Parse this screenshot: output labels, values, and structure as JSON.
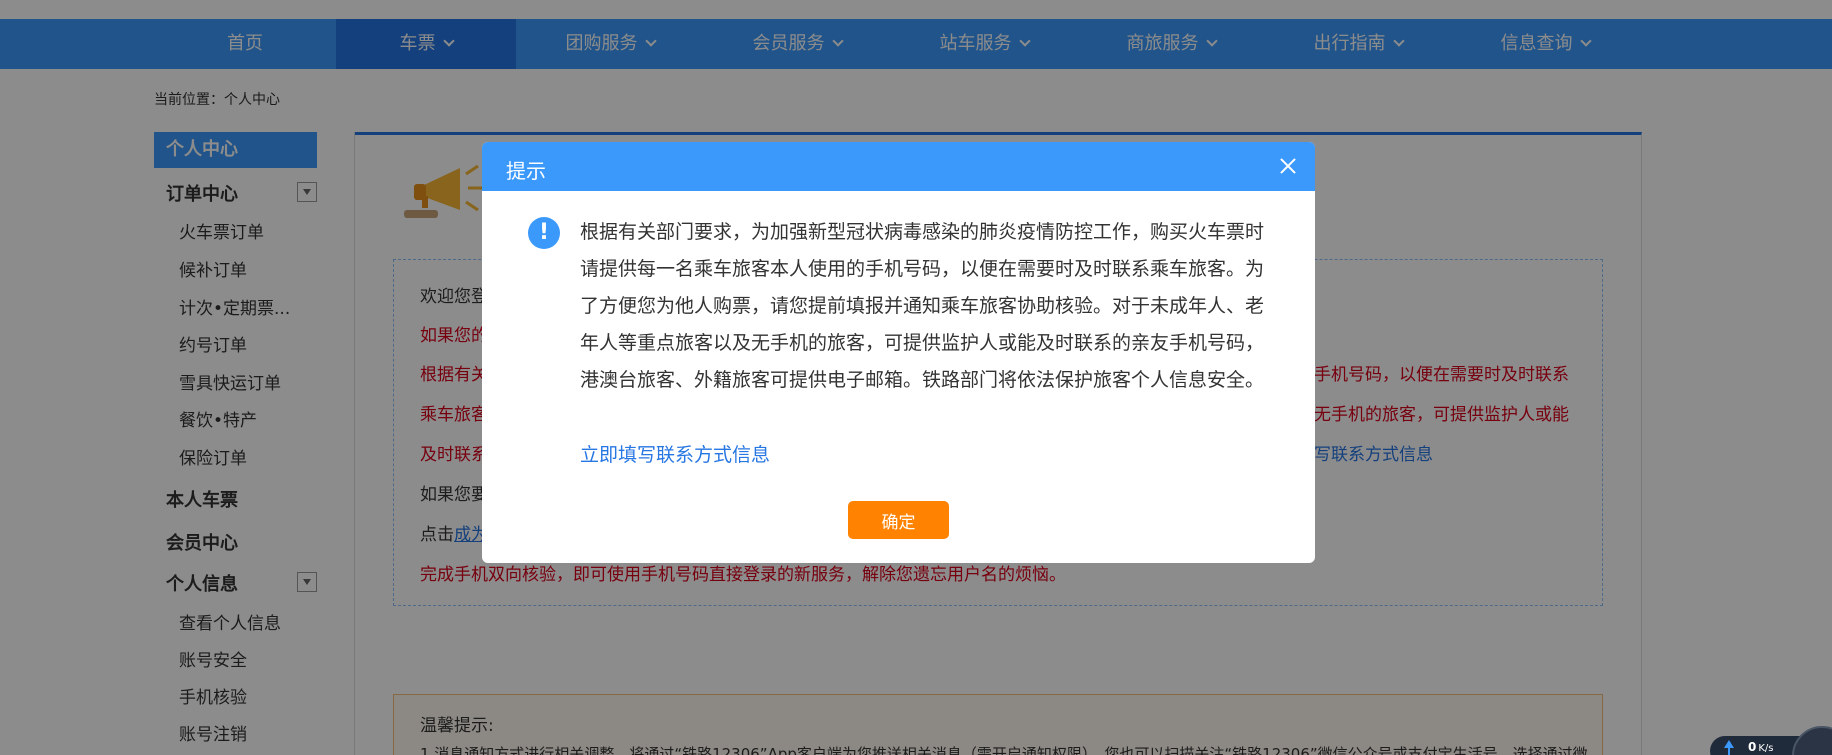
{
  "nav": {
    "items": [
      {
        "label": "首页",
        "dropdown": false
      },
      {
        "label": "车票",
        "dropdown": true,
        "active": true
      },
      {
        "label": "团购服务",
        "dropdown": true
      },
      {
        "label": "会员服务",
        "dropdown": true
      },
      {
        "label": "站车服务",
        "dropdown": true
      },
      {
        "label": "商旅服务",
        "dropdown": true
      },
      {
        "label": "出行指南",
        "dropdown": true
      },
      {
        "label": "信息查询",
        "dropdown": true
      }
    ]
  },
  "breadcrumb": "当前位置：个人中心",
  "sidebar": {
    "header": "个人中心",
    "order_center": "订单中心",
    "order_items": [
      "火车票订单",
      "候补订单",
      "计次•定期票...",
      "约号订单",
      "雪具快运订单",
      "餐饮•特产",
      "保险订单"
    ],
    "own_tickets": "本人车票",
    "member_center": "会员中心",
    "personal_info": "个人信息",
    "personal_items": [
      "查看个人信息",
      "账号安全",
      "手机核验",
      "账号注销"
    ]
  },
  "welcome": {
    "line1": "欢迎您登",
    "line2": "如果您的",
    "line3_left": "根据有关",
    "line3_right": "手机号码，以便在需要时及时联系",
    "line4_left": "乘车旅客",
    "line4_right": "无手机的旅客，可提供监护人或能",
    "line5_left": "及时联系",
    "line5_right": "写联系方式信息",
    "line6": "如果您要",
    "line7_prefix": "点击",
    "line7_link": "成为",
    "line8": "完成手机双向核验，即可使用手机号码直接登录的新服务，解除您遗忘用户名的烦恼。"
  },
  "tips": {
    "title": "温馨提示:",
    "line1": "1.消息通知方式进行相关调整，将通过“铁路12306”App客户端为您推送相关消息（需开启通知权限），您也可以扫描关注“铁路12306”微信公众号或支付宝生活号，选择通过微"
  },
  "modal": {
    "title": "提示",
    "message": "根据有关部门要求，为加强新型冠状病毒感染的肺炎疫情防控工作，购买火车票时请提供每一名乘车旅客本人使用的手机号码，以便在需要时及时联系乘车旅客。为了方便您为他人购票，请您提前填报并通知乘车旅客协助核验。对于未成年人、老年人等重点旅客以及无手机的旅客，可提供监护人或能及时联系的亲友手机号码，港澳台旅客、外籍旅客可提供电子邮箱。铁路部门将依法保护旅客个人信息安全。",
    "link": "立即填写联系方式信息",
    "ok": "确定"
  },
  "speed": {
    "value": "0",
    "unit": "K/s"
  }
}
